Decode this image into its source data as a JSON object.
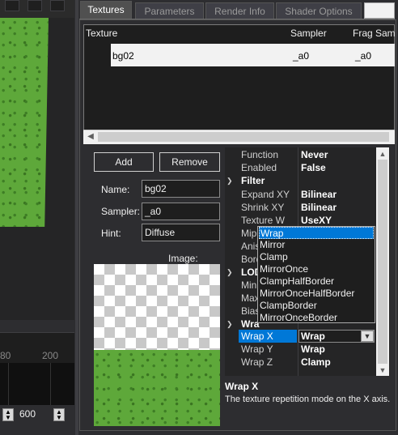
{
  "tabs": [
    {
      "label": "Textures"
    },
    {
      "label": "Parameters"
    },
    {
      "label": "Render Info"
    },
    {
      "label": "Shader Options"
    }
  ],
  "texture_list": {
    "headers": [
      "Texture",
      "Sampler",
      "Frag Sam"
    ],
    "rows": [
      {
        "texture": "bg02",
        "sampler": "_a0",
        "frag_sampler": "_a0"
      }
    ]
  },
  "buttons": {
    "add": "Add",
    "remove": "Remove"
  },
  "form": {
    "name_label": "Name:",
    "name_value": "bg02",
    "sampler_label": "Sampler:",
    "sampler_value": "_a0",
    "hint_label": "Hint:",
    "hint_value": "Diffuse",
    "image_label": "Image:"
  },
  "timeline": {
    "tick_a": "80",
    "tick_b": "200",
    "frame_value": "600"
  },
  "properties": {
    "function": {
      "name": "Function",
      "value": "Never"
    },
    "enabled": {
      "name": "Enabled",
      "value": "False"
    },
    "filter_category": "Filter",
    "expand_xy": {
      "name": "Expand XY",
      "value": "Bilinear"
    },
    "shrink_xy": {
      "name": "Shrink XY",
      "value": "Bilinear"
    },
    "texture_w": {
      "name": "Texture W",
      "value": "UseXY"
    },
    "mip_partial": "Mip",
    "aniso_partial": "Anis",
    "border_partial": "Bord",
    "lod_partial": "LOD",
    "min_partial": "Min",
    "max_partial": "Max",
    "bias_partial": "Bias",
    "wrap_partial": "Wra",
    "wrap_x": {
      "name": "Wrap X",
      "value": "Wrap"
    },
    "wrap_y": {
      "name": "Wrap Y",
      "value": "Wrap"
    },
    "wrap_z": {
      "name": "Wrap Z",
      "value": "Clamp"
    }
  },
  "wrap_dropdown": {
    "options": [
      "Wrap",
      "Mirror",
      "Clamp",
      "MirrorOnce",
      "ClampHalfBorder",
      "MirrorOnceHalfBorder",
      "ClampBorder",
      "MirrorOnceBorder"
    ],
    "selected": "Wrap"
  },
  "description": {
    "title": "Wrap X",
    "text": "The texture repetition mode on the X axis."
  },
  "colors": {
    "background": "#2d2d30",
    "selection": "#0078d7",
    "texture_green": "#5ea83a"
  }
}
